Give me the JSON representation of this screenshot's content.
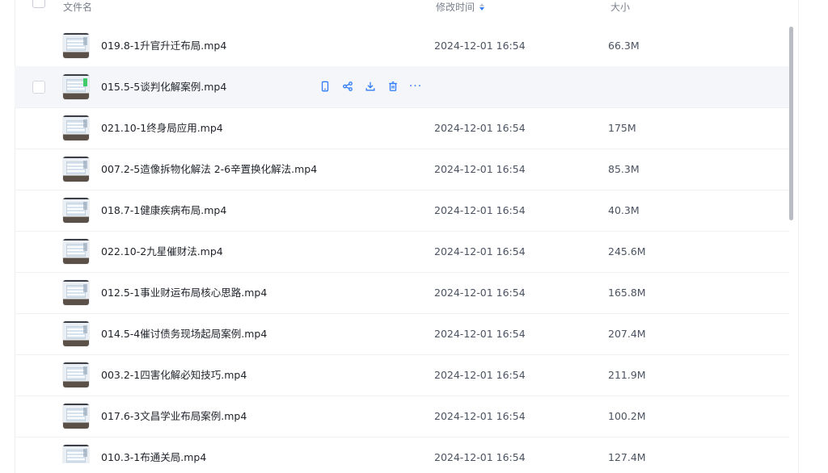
{
  "header": {
    "name_label": "文件名",
    "time_label": "修改时间",
    "size_label": "大小"
  },
  "colors": {
    "accent": "#2f7cf6",
    "hover_row": "#f5f6f9"
  },
  "actions_icons": [
    "phone-icon",
    "share-icon",
    "download-icon",
    "delete-icon",
    "more-icon"
  ],
  "more_glyph": "···",
  "files": [
    {
      "name": "019.8-1升官升迁布局.mp4",
      "time": "2024-12-01 16:54",
      "size": "66.3M"
    },
    {
      "name": "015.5-5谈判化解案例.mp4",
      "time": "",
      "size": ""
    },
    {
      "name": "021.10-1终身局应用.mp4",
      "time": "2024-12-01 16:54",
      "size": "175M"
    },
    {
      "name": "007.2-5造像拆物化解法 2-6辛置换化解法.mp4",
      "time": "2024-12-01 16:54",
      "size": "85.3M"
    },
    {
      "name": "018.7-1健康疾病布局.mp4",
      "time": "2024-12-01 16:54",
      "size": "40.3M"
    },
    {
      "name": "022.10-2九星催财法.mp4",
      "time": "2024-12-01 16:54",
      "size": "245.6M"
    },
    {
      "name": "012.5-1事业财运布局核心思路.mp4",
      "time": "2024-12-01 16:54",
      "size": "165.8M"
    },
    {
      "name": "014.5-4催讨债务现场起局案例.mp4",
      "time": "2024-12-01 16:54",
      "size": "207.4M"
    },
    {
      "name": "003.2-1四害化解必知技巧.mp4",
      "time": "2024-12-01 16:54",
      "size": "211.9M"
    },
    {
      "name": "017.6-3文昌学业布局案例.mp4",
      "time": "2024-12-01 16:54",
      "size": "100.2M"
    },
    {
      "name": "010.3-1布通关局.mp4",
      "time": "2024-12-01 16:54",
      "size": "127.4M"
    }
  ]
}
